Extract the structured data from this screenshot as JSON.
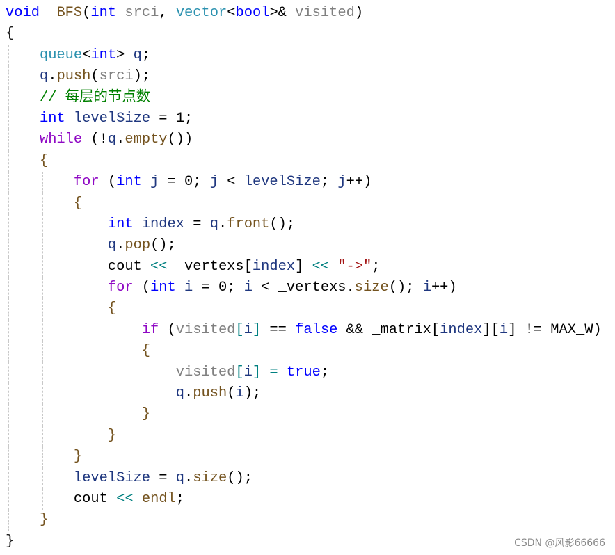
{
  "colors": {
    "keyword": "#0000ff",
    "control": "#8f08c4",
    "type": "#2b91af",
    "parameter": "#808080",
    "function": "#74531f",
    "comment": "#008000",
    "string": "#a31515",
    "local": "#1f377f",
    "operator": "#008080"
  },
  "code_lines": [
    {
      "indent": 0,
      "tokens": [
        [
          "void",
          "kw"
        ],
        [
          " ",
          "plain"
        ],
        [
          "_BFS",
          "fn"
        ],
        [
          "(",
          "plain"
        ],
        [
          "int",
          "kw"
        ],
        [
          " ",
          "plain"
        ],
        [
          "srci",
          "param"
        ],
        [
          ", ",
          "plain"
        ],
        [
          "vector",
          "type"
        ],
        [
          "<",
          "plain"
        ],
        [
          "bool",
          "kw"
        ],
        [
          ">& ",
          "plain"
        ],
        [
          "visited",
          "param"
        ],
        [
          ")",
          "plain"
        ]
      ]
    },
    {
      "indent": 0,
      "tokens": [
        [
          "{",
          "brace0"
        ]
      ]
    },
    {
      "indent": 1,
      "tokens": [
        [
          "queue",
          "type"
        ],
        [
          "<",
          "plain"
        ],
        [
          "int",
          "kw"
        ],
        [
          "> ",
          "plain"
        ],
        [
          "q",
          "var"
        ],
        [
          ";",
          "plain"
        ]
      ]
    },
    {
      "indent": 1,
      "tokens": [
        [
          "q",
          "var"
        ],
        [
          ".",
          "plain"
        ],
        [
          "push",
          "fn"
        ],
        [
          "(",
          "plain"
        ],
        [
          "srci",
          "param"
        ],
        [
          ");",
          "plain"
        ]
      ]
    },
    {
      "indent": 1,
      "tokens": [
        [
          "// 每层的节点数",
          "cm"
        ]
      ]
    },
    {
      "indent": 1,
      "tokens": [
        [
          "int",
          "kw"
        ],
        [
          " ",
          "plain"
        ],
        [
          "levelSize",
          "var"
        ],
        [
          " = 1;",
          "plain"
        ]
      ]
    },
    {
      "indent": 1,
      "tokens": [
        [
          "while",
          "ctl"
        ],
        [
          " (!",
          "plain"
        ],
        [
          "q",
          "var"
        ],
        [
          ".",
          "plain"
        ],
        [
          "empty",
          "fn"
        ],
        [
          "())",
          "plain"
        ]
      ]
    },
    {
      "indent": 1,
      "tokens": [
        [
          "{",
          "brace"
        ]
      ]
    },
    {
      "indent": 2,
      "tokens": [
        [
          "for",
          "ctl"
        ],
        [
          " (",
          "plain"
        ],
        [
          "int",
          "kw"
        ],
        [
          " ",
          "plain"
        ],
        [
          "j",
          "var"
        ],
        [
          " = 0; ",
          "plain"
        ],
        [
          "j",
          "var"
        ],
        [
          " < ",
          "plain"
        ],
        [
          "levelSize",
          "var"
        ],
        [
          "; ",
          "plain"
        ],
        [
          "j",
          "var"
        ],
        [
          "++)",
          "plain"
        ]
      ]
    },
    {
      "indent": 2,
      "tokens": [
        [
          "{",
          "brace"
        ]
      ]
    },
    {
      "indent": 3,
      "tokens": [
        [
          "int",
          "kw"
        ],
        [
          " ",
          "plain"
        ],
        [
          "index",
          "var"
        ],
        [
          " = ",
          "plain"
        ],
        [
          "q",
          "var"
        ],
        [
          ".",
          "plain"
        ],
        [
          "front",
          "fn"
        ],
        [
          "();",
          "plain"
        ]
      ]
    },
    {
      "indent": 3,
      "tokens": [
        [
          "q",
          "var"
        ],
        [
          ".",
          "plain"
        ],
        [
          "pop",
          "fn"
        ],
        [
          "();",
          "plain"
        ]
      ]
    },
    {
      "indent": 3,
      "tokens": [
        [
          "cout",
          "plain"
        ],
        [
          " ",
          "plain"
        ],
        [
          "<<",
          "op"
        ],
        [
          " _vertexs[",
          "plain"
        ],
        [
          "index",
          "var"
        ],
        [
          "] ",
          "plain"
        ],
        [
          "<<",
          "op"
        ],
        [
          " ",
          "plain"
        ],
        [
          "″->″",
          "str"
        ],
        [
          ";",
          "plain"
        ]
      ]
    },
    {
      "indent": 3,
      "tokens": [
        [
          "for",
          "ctl"
        ],
        [
          " (",
          "plain"
        ],
        [
          "int",
          "kw"
        ],
        [
          " ",
          "plain"
        ],
        [
          "i",
          "var"
        ],
        [
          " = 0; ",
          "plain"
        ],
        [
          "i",
          "var"
        ],
        [
          " < _vertexs.",
          "plain"
        ],
        [
          "size",
          "fn"
        ],
        [
          "(); ",
          "plain"
        ],
        [
          "i",
          "var"
        ],
        [
          "++)",
          "plain"
        ]
      ]
    },
    {
      "indent": 3,
      "tokens": [
        [
          "{",
          "brace"
        ]
      ]
    },
    {
      "indent": 4,
      "tokens": [
        [
          "if",
          "ctl"
        ],
        [
          " (",
          "plain"
        ],
        [
          "visited",
          "param"
        ],
        [
          "[",
          "op"
        ],
        [
          "i",
          "var"
        ],
        [
          "]",
          "op"
        ],
        [
          " == ",
          "plain"
        ],
        [
          "false",
          "kw"
        ],
        [
          " && _matrix[",
          "plain"
        ],
        [
          "index",
          "var"
        ],
        [
          "][",
          "plain"
        ],
        [
          "i",
          "var"
        ],
        [
          "] != MAX_W)",
          "plain"
        ]
      ]
    },
    {
      "indent": 4,
      "tokens": [
        [
          "{",
          "brace"
        ]
      ]
    },
    {
      "indent": 5,
      "tokens": [
        [
          "visited",
          "param"
        ],
        [
          "[",
          "op"
        ],
        [
          "i",
          "var"
        ],
        [
          "]",
          "op"
        ],
        [
          " ",
          "plain"
        ],
        [
          "=",
          "op"
        ],
        [
          " ",
          "plain"
        ],
        [
          "true",
          "kw"
        ],
        [
          ";",
          "plain"
        ]
      ]
    },
    {
      "indent": 5,
      "tokens": [
        [
          "q",
          "var"
        ],
        [
          ".",
          "plain"
        ],
        [
          "push",
          "fn"
        ],
        [
          "(",
          "plain"
        ],
        [
          "i",
          "var"
        ],
        [
          ");",
          "plain"
        ]
      ]
    },
    {
      "indent": 4,
      "tokens": [
        [
          "}",
          "brace"
        ]
      ]
    },
    {
      "indent": 3,
      "tokens": [
        [
          "}",
          "brace"
        ]
      ]
    },
    {
      "indent": 2,
      "tokens": [
        [
          "}",
          "brace"
        ]
      ]
    },
    {
      "indent": 2,
      "tokens": [
        [
          "levelSize",
          "var"
        ],
        [
          " = ",
          "plain"
        ],
        [
          "q",
          "var"
        ],
        [
          ".",
          "plain"
        ],
        [
          "size",
          "fn"
        ],
        [
          "();",
          "plain"
        ]
      ]
    },
    {
      "indent": 2,
      "tokens": [
        [
          "cout",
          "plain"
        ],
        [
          " ",
          "plain"
        ],
        [
          "<<",
          "op"
        ],
        [
          " ",
          "plain"
        ],
        [
          "endl",
          "fn"
        ],
        [
          ";",
          "plain"
        ]
      ]
    },
    {
      "indent": 1,
      "tokens": [
        [
          "}",
          "brace"
        ]
      ]
    },
    {
      "indent": 0,
      "tokens": [
        [
          "}",
          "brace0"
        ]
      ]
    }
  ],
  "watermark": "CSDN @风影66666"
}
